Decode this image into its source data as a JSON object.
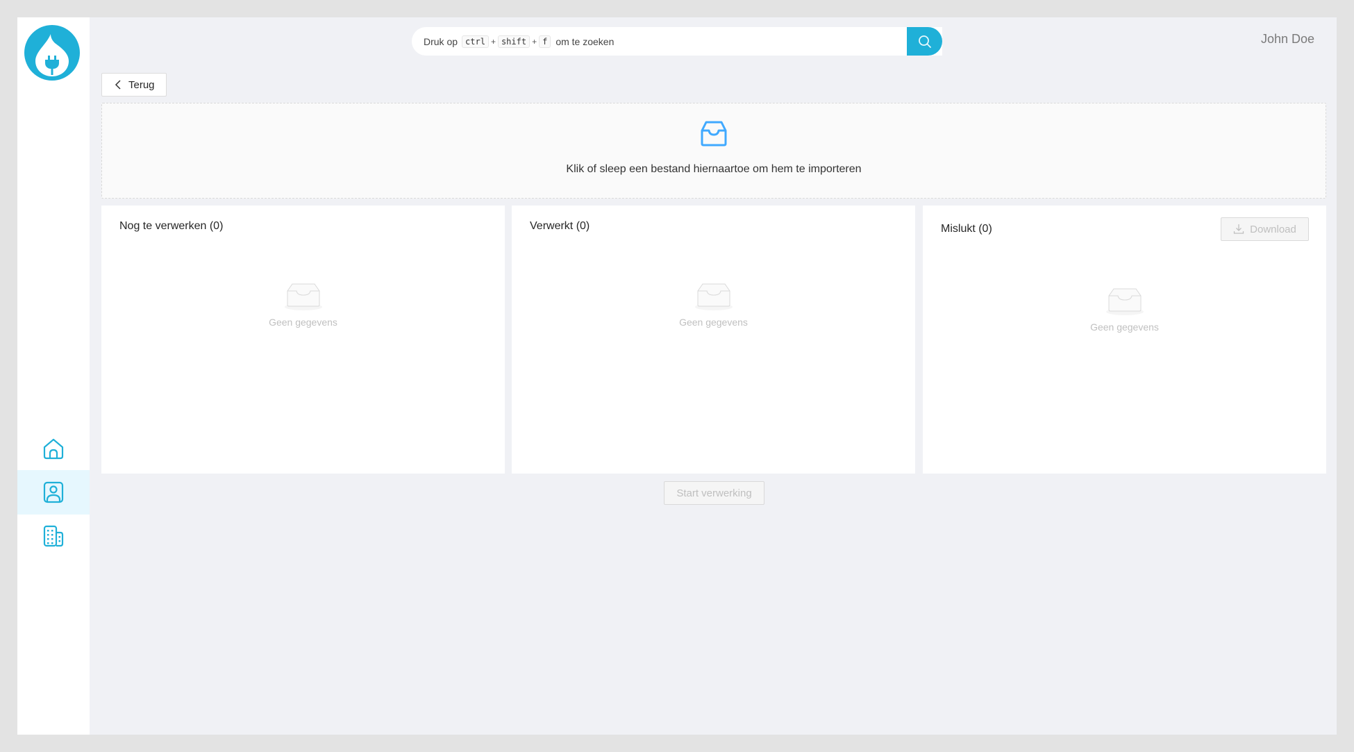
{
  "app": {
    "user_name": "John Doe",
    "brand_color": "#1fb0d8",
    "accent_color": "#40a9ff"
  },
  "sidebar": {
    "logo": "flame-plug-logo",
    "items": [
      {
        "icon": "home-icon",
        "label": "Home",
        "active": false
      },
      {
        "icon": "user-profile-icon",
        "label": "Contacts",
        "active": true
      },
      {
        "icon": "building-icon",
        "label": "Companies",
        "active": false
      }
    ]
  },
  "search": {
    "prefix": "Druk op",
    "keys": [
      "ctrl",
      "shift",
      "f"
    ],
    "separator": "+",
    "suffix": "om te zoeken",
    "button_icon": "search-icon"
  },
  "back_button": {
    "label": "Terug",
    "icon": "chevron-left-icon"
  },
  "dropzone": {
    "icon": "inbox-icon",
    "text": "Klik of sleep een bestand hiernaartoe om hem te importeren"
  },
  "panels": [
    {
      "title": "Nog te verwerken (0)",
      "empty_text": "Geen gegevens"
    },
    {
      "title": "Verwerkt (0)",
      "empty_text": "Geen gegevens"
    },
    {
      "title": "Mislukt (0)",
      "empty_text": "Geen gegevens",
      "action": {
        "label": "Download",
        "icon": "download-icon",
        "disabled": true
      }
    }
  ],
  "start_button": {
    "label": "Start verwerking",
    "disabled": true
  }
}
